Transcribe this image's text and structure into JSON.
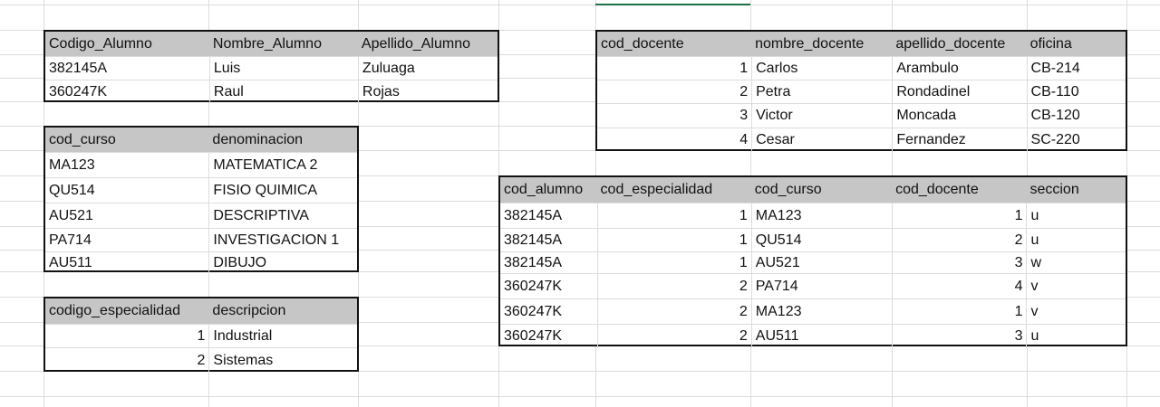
{
  "tables": {
    "alumnos": {
      "headers": [
        "Codigo_Alumno",
        "Nombre_Alumno",
        "Apellido_Alumno"
      ],
      "rows": [
        [
          "382145A",
          "Luis",
          "Zuluaga"
        ],
        [
          "360247K",
          "Raul",
          "Rojas"
        ]
      ]
    },
    "cursos": {
      "headers": [
        "cod_curso",
        "denominacion"
      ],
      "rows": [
        [
          "MA123",
          "MATEMATICA 2"
        ],
        [
          "QU514",
          "FISIO QUIMICA"
        ],
        [
          "AU521",
          "DESCRIPTIVA"
        ],
        [
          "PA714",
          "INVESTIGACION 1"
        ],
        [
          "AU511",
          "DIBUJO"
        ]
      ]
    },
    "especialidades": {
      "headers": [
        "codigo_especialidad",
        "descripcion"
      ],
      "rows": [
        [
          "1",
          "Industrial"
        ],
        [
          "2",
          "Sistemas"
        ]
      ]
    },
    "docentes": {
      "headers": [
        "cod_docente",
        "nombre_docente",
        "apellido_docente",
        "oficina"
      ],
      "rows": [
        [
          "1",
          "Carlos",
          "Arambulo",
          "CB-214"
        ],
        [
          "2",
          "Petra",
          "Rondadinel",
          "CB-110"
        ],
        [
          "3",
          "Victor",
          "Moncada",
          "CB-120"
        ],
        [
          "4",
          "Cesar",
          "Fernandez",
          "SC-220"
        ]
      ]
    },
    "matriculas": {
      "headers": [
        "cod_alumno",
        "cod_especialidad",
        "cod_curso",
        "cod_docente",
        "seccion"
      ],
      "rows": [
        [
          "382145A",
          "1",
          "MA123",
          "1",
          "u"
        ],
        [
          "382145A",
          "1",
          "QU514",
          "2",
          "u"
        ],
        [
          "382145A",
          "1",
          "AU521",
          "3",
          "w"
        ],
        [
          "360247K",
          "2",
          "PA714",
          "4",
          "v"
        ],
        [
          "360247K",
          "2",
          "MA123",
          "1",
          "v"
        ],
        [
          "360247K",
          "2",
          "AU511",
          "3",
          "u"
        ]
      ]
    }
  }
}
